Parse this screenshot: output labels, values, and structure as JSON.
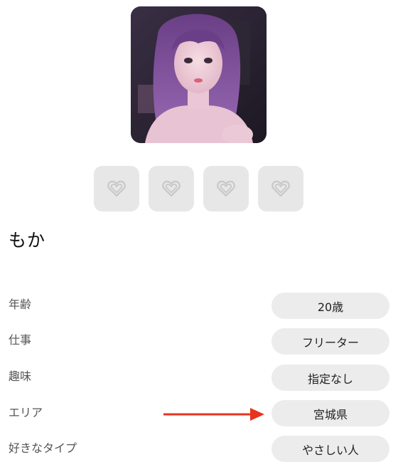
{
  "profile": {
    "name": "もか"
  },
  "gifts": [
    {
      "icon": "heart-outline-icon"
    },
    {
      "icon": "heart-outline-icon"
    },
    {
      "icon": "heart-outline-icon"
    },
    {
      "icon": "heart-outline-icon"
    }
  ],
  "attributes": [
    {
      "label": "年齢",
      "value": "20歳"
    },
    {
      "label": "仕事",
      "value": "フリーター"
    },
    {
      "label": "趣味",
      "value": "指定なし"
    },
    {
      "label": "エリア",
      "value": "宮城県"
    },
    {
      "label": "好きなタイプ",
      "value": "やさしい人"
    }
  ],
  "colors": {
    "accent_arrow": "#e8331f",
    "pill_background": "#ececec",
    "slot_background": "#e7e7e7"
  }
}
